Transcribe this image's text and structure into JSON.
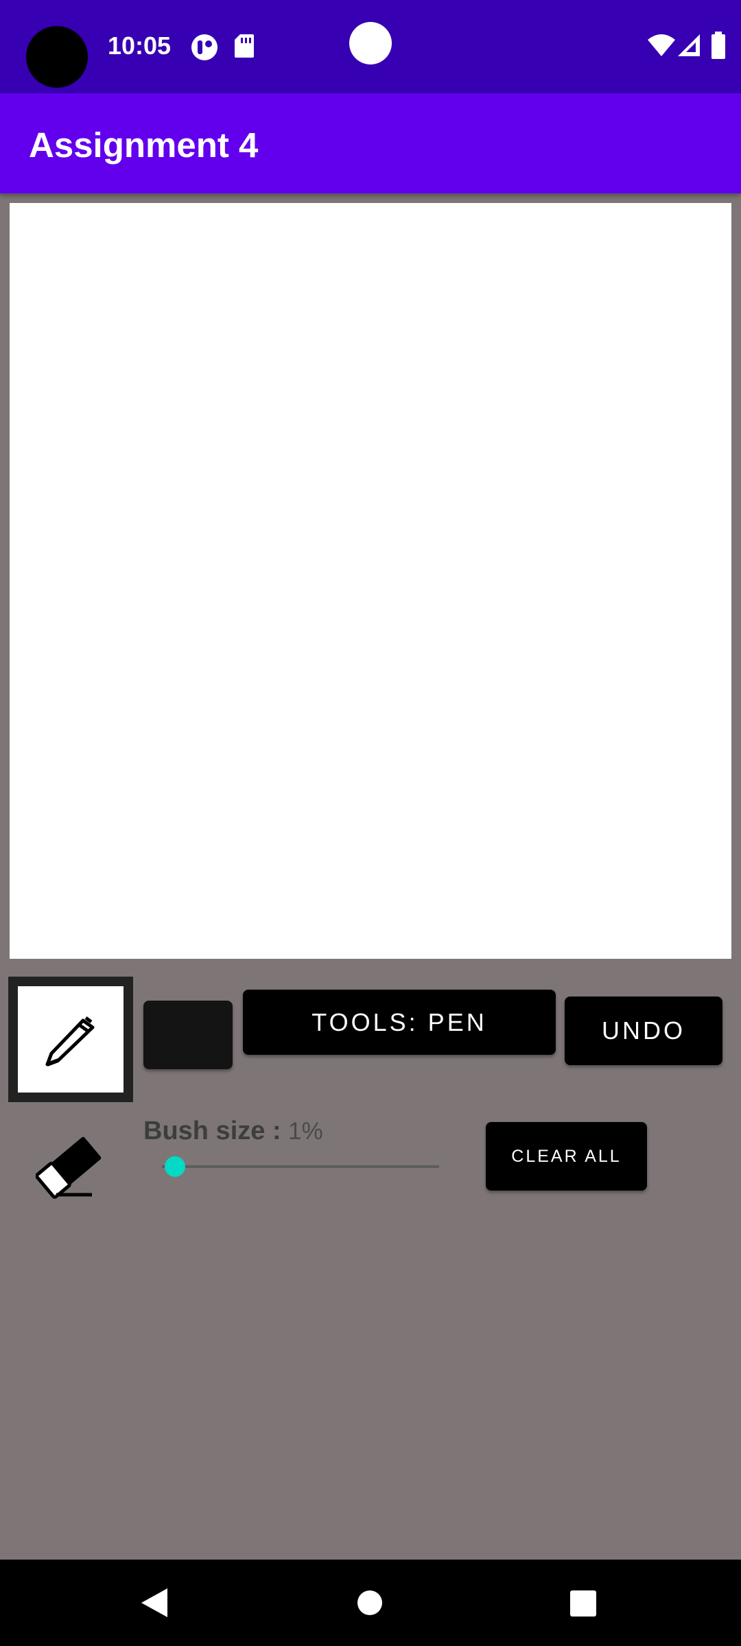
{
  "status_bar": {
    "time": "10:05",
    "icons": [
      "notification-app-icon",
      "sd-card-icon",
      "wifi-icon",
      "cellular-signal-icon",
      "battery-icon"
    ]
  },
  "app_bar": {
    "title": "Assignment 4"
  },
  "toolbar": {
    "pen_tool_icon": "pen-icon",
    "selected_color": "#141414",
    "tools_label": "TOOLS: PEN",
    "undo_label": "UNDO",
    "clear_all_label": "CLEAR ALL",
    "eraser_icon": "eraser-icon"
  },
  "brush": {
    "label": "Bush size :",
    "value_text": "1%",
    "value": 1,
    "accent_color": "#03dac5"
  },
  "nav_bar": {
    "icons": [
      "back-icon",
      "home-icon",
      "recents-icon"
    ]
  },
  "colors": {
    "status_bar": "#3700b3",
    "app_bar": "#6200ee",
    "background": "#7e7676"
  }
}
